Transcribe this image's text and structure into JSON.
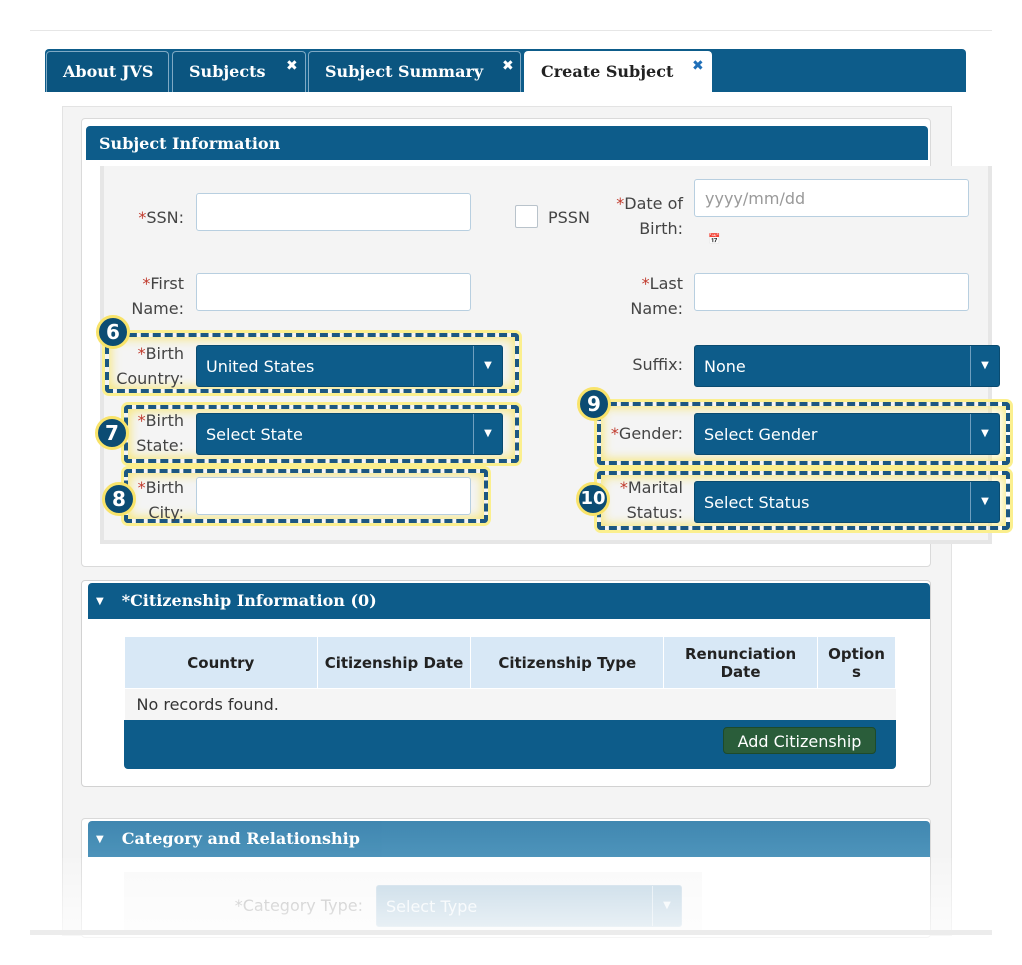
{
  "tabs": [
    {
      "label": "About JVS",
      "closable": false
    },
    {
      "label": "Subjects",
      "closable": true
    },
    {
      "label": "Subject Summary",
      "closable": true
    },
    {
      "label": "Create Subject",
      "closable": true,
      "active": true
    }
  ],
  "close_glyph": "✖",
  "subject_info": {
    "title": "Subject Information",
    "required_mark": "*",
    "ssn_label": "SSN:",
    "pssn_label": "PSSN",
    "dob_label_1": "Date of",
    "dob_label_2": "Birth:",
    "dob_placeholder": "yyyy/mm/dd",
    "first_name_label_1": "First",
    "first_name_label_2": "Name:",
    "last_name_label_1": "Last",
    "last_name_label_2": "Name:",
    "birth_country_label_1": "Birth",
    "birth_country_label_2": "Country:",
    "birth_country_value": "United States",
    "suffix_label": "Suffix:",
    "suffix_value": "None",
    "birth_state_label_1": "Birth",
    "birth_state_label_2": "State:",
    "birth_state_value": "Select State",
    "gender_label": "Gender:",
    "gender_value": "Select Gender",
    "birth_city_label_1": "Birth",
    "birth_city_label_2": "City:",
    "marital_label_1": "Marital",
    "marital_label_2": "Status:",
    "marital_value": "Select Status"
  },
  "callouts": [
    "6",
    "7",
    "8",
    "9",
    "10"
  ],
  "citizenship": {
    "title": "*Citizenship Information (0)",
    "columns": [
      "Country",
      "Citizenship Date",
      "Citizenship Type",
      "Renunciation Date",
      "Option s"
    ],
    "empty_message": "No records found.",
    "add_button": "Add Citizenship"
  },
  "category": {
    "title": "Category and Relationship",
    "category_type_label": "*Category Type:",
    "category_type_value": "Select Type"
  },
  "colors": {
    "primary": "#0d5c8a",
    "highlight": "#fbef8e",
    "required": "#c0392b",
    "add_button": "#2a5d3a"
  }
}
